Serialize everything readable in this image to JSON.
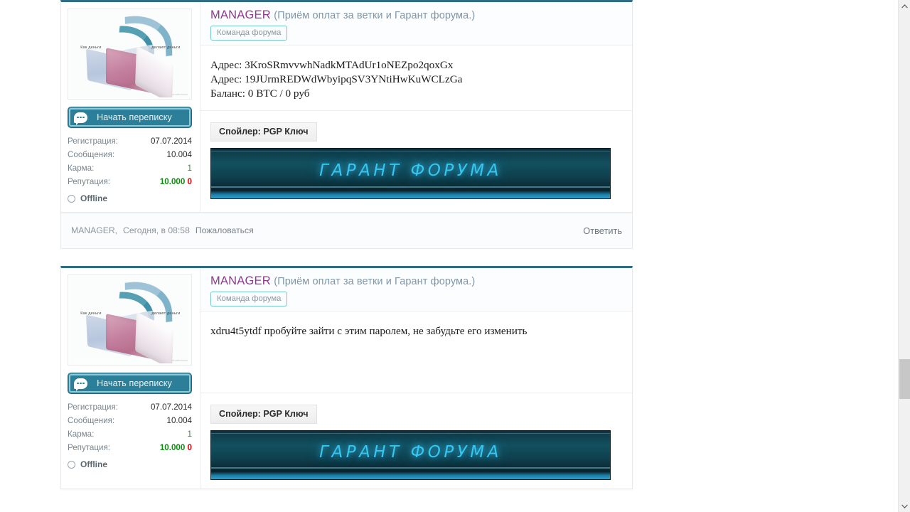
{
  "scrollbar": {
    "up_arrow": "▲",
    "down_arrow": "▼"
  },
  "user": {
    "name": "MANAGER",
    "title": "(Приём оплат за ветки и Гарант форума.)",
    "team_badge": "Команда форума",
    "pm_button": "Начать переписку",
    "avatar_caption_left": "Как деньги",
    "avatar_caption_right": "делают деньги",
    "avatar_watermark": "shutterstock",
    "stats": [
      {
        "label": "Регистрация:",
        "value": "07.07.2014",
        "style": "plain"
      },
      {
        "label": "Сообщения:",
        "value": "10.004",
        "style": "plain"
      },
      {
        "label": "Карма:",
        "value": "1",
        "style": "muted-green"
      }
    ],
    "reputation_label": "Репутация:",
    "reputation_positive": "10.000",
    "reputation_negative": "0",
    "status": "Offline"
  },
  "posts": [
    {
      "body_lines": [
        "Адрес: 3KroSRmvvwhNadkMTAdUr1oNEZpo2qoxGx",
        "Адрес: 19JUrmREDWdWbyipqSV3YNtiHwKuWCLzGa",
        "Баланс: 0 BTC / 0 руб"
      ],
      "spoiler_label": "Спойлер: PGP Ключ",
      "banner_text": "ГАРАНТ ФОРУМА",
      "footer_author": "MANAGER,",
      "footer_time": "Сегодня, в 08:58",
      "footer_report": "Пожаловаться",
      "footer_reply": "Ответить"
    },
    {
      "body_lines": [
        "xdru4t5ytdf пробуйте зайти с этим паролем, не забудьте его изменить"
      ],
      "spoiler_label": "Спойлер: PGP Ключ",
      "banner_text": "ГАРАНТ ФОРУМА"
    }
  ],
  "colors": {
    "post_top_border": "#2e6d83",
    "username": "#8e3a8e",
    "usertitle": "#7f96a6",
    "pm_button_bg": "#2b7f99",
    "badge_border": "#76c5c9",
    "rep_positive": "#138a13",
    "rep_negative": "#cc0000",
    "banner_glow": "#35c6f2"
  }
}
